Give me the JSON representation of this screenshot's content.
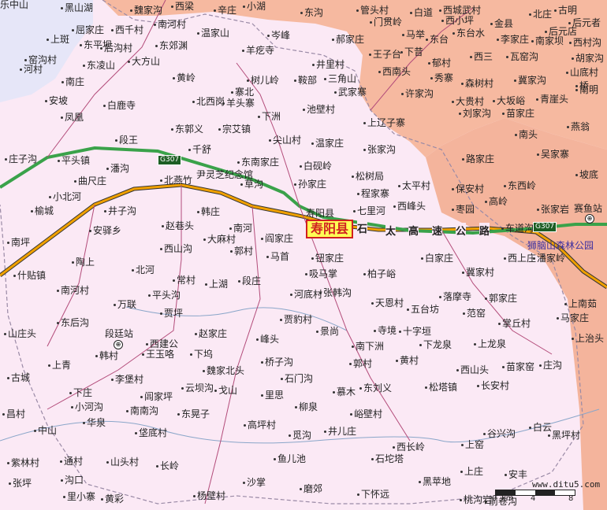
{
  "county": "寿阳县",
  "county_seat": "寿阳县",
  "highway_shield": "G307",
  "highway_name_chars": [
    "石",
    "太",
    "高",
    "速",
    "公",
    "路"
  ],
  "stations": [
    {
      "name": "段廷站"
    },
    {
      "name": "赛鱼站"
    }
  ],
  "park": "狮脑山森林公园",
  "memorial": "尹灵芝纪念馆",
  "watermark": "www.ditu5.com",
  "scale": {
    "zero": "0",
    "mid": "4",
    "end": "8",
    "unit": "km"
  },
  "places": [
    "黑山湖",
    "魏家沟",
    "西梁",
    "辛庄",
    "小湖",
    "东沟",
    "管头村",
    "白道",
    "西城武村",
    "北庄",
    "古明",
    "后元者",
    "屈家庄",
    "西千村",
    "南河村",
    "温家山",
    "岑峰",
    "郝家庄",
    "门贯岭",
    "西小坪",
    "金县",
    "后元店",
    "上斑",
    "东平坝",
    "马举",
    "东台",
    "东台水",
    "李家庄",
    "南家坝",
    "西村沟",
    "窑沟村",
    "后沟村",
    "东郊渊",
    "羊疙寺",
    "井里村",
    "王子台",
    "下昔",
    "郁村",
    "西三",
    "瓦窑沟",
    "胡家沟",
    "河村",
    "大方山",
    "东凌山",
    "南庄",
    "黄岭",
    "树儿岭",
    "鞍部",
    "三角山",
    "武家寨",
    "西南头",
    "秀寨",
    "森树村",
    "冀家沟",
    "山底村",
    "桥",
    "安坡",
    "北西岗",
    "寨北",
    "羊头寨",
    "下洲",
    "许家沟",
    "大贵村",
    "大坂峪",
    "青崖头",
    "南明",
    "凤凰",
    "白鹿寺",
    "池壁村",
    "上辽子寨",
    "刘家沟",
    "苗家庄",
    "东郭义",
    "宗艾镇",
    "燕翁",
    "段王",
    "尖山村",
    "温家庄",
    "张家沟",
    "南头",
    "吴家寨",
    "庄子沟",
    "平头镇",
    "潘沟",
    "千舒",
    "东南家庄",
    "白砚岭",
    "路家庄",
    "坡底",
    "曲尺庄",
    "北燕竹",
    "草沟",
    "孙家庄",
    "松树局",
    "太平村",
    "保安村",
    "东西岭",
    "小北河",
    "程家寨",
    "西峰头",
    "枣园",
    "高岭",
    "榆城",
    "井子沟",
    "韩庄",
    "七里河",
    "张家岩",
    "车道沟",
    "南坪",
    "安驿乡",
    "赵巷头",
    "南河",
    "阎家庄",
    "大麻村",
    "郭村",
    "西上庄",
    "潘家岭",
    "陶上",
    "西山沟",
    "马首",
    "钮家庄",
    "白家庄",
    "北河",
    "吸马掌",
    "柏子峪",
    "冀家村",
    "什贴镇",
    "常村",
    "上湖",
    "段庄",
    "河底村",
    "张韩沟",
    "落摩寺",
    "郭家庄",
    "南河村",
    "万联",
    "平头沟",
    "贾坪",
    "贾豹村",
    "天恩村",
    "五台坊",
    "范窑",
    "上南茹",
    "山庄头",
    "东后沟",
    "景尚",
    "寺境",
    "十字垣",
    "掌丘村",
    "马家庄",
    "西建公",
    "赵家庄",
    "峰头",
    "南下洲",
    "下龙泉",
    "上龙泉",
    "上治头",
    "韩村",
    "王玉咯",
    "下坞",
    "魏家北头",
    "桥子沟",
    "郭村",
    "黄村",
    "西山头",
    "苗家窑",
    "庄沟",
    "上青",
    "古城",
    "李堡村",
    "云坝沟",
    "戈山",
    "石门沟",
    "东刘义",
    "松塔镇",
    "长安村",
    "下庄",
    "小河沟",
    "闾家坪",
    "慕木",
    "里思",
    "昌村",
    "南南沟",
    "峪壁村",
    "柳泉",
    "华泉",
    "垡底村",
    "东晃子",
    "高坪村",
    "觅沟",
    "井儿庄",
    "白云",
    "黑坪村",
    "中山",
    "谷兴沟",
    "西长岭",
    "上窑",
    "紫林村",
    "通村",
    "山头村",
    "鱼儿池",
    "石坨塔",
    "沟口",
    "长岭",
    "张坪",
    "杨壁村",
    "沙掌",
    "磨郊",
    "上庄",
    "安丰",
    "里小寨",
    "黄彩",
    "下怀远",
    "黑苹地",
    "桃沟岩",
    "前卷沟",
    "乐中山"
  ]
}
